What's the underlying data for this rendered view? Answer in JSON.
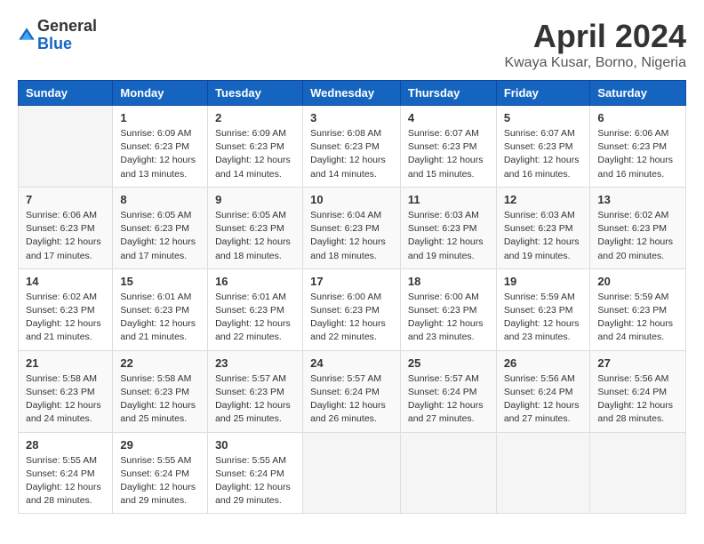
{
  "logo": {
    "general": "General",
    "blue": "Blue"
  },
  "title": "April 2024",
  "location": "Kwaya Kusar, Borno, Nigeria",
  "weekdays": [
    "Sunday",
    "Monday",
    "Tuesday",
    "Wednesday",
    "Thursday",
    "Friday",
    "Saturday"
  ],
  "weeks": [
    [
      {
        "day": "",
        "detail": ""
      },
      {
        "day": "1",
        "detail": "Sunrise: 6:09 AM\nSunset: 6:23 PM\nDaylight: 12 hours\nand 13 minutes."
      },
      {
        "day": "2",
        "detail": "Sunrise: 6:09 AM\nSunset: 6:23 PM\nDaylight: 12 hours\nand 14 minutes."
      },
      {
        "day": "3",
        "detail": "Sunrise: 6:08 AM\nSunset: 6:23 PM\nDaylight: 12 hours\nand 14 minutes."
      },
      {
        "day": "4",
        "detail": "Sunrise: 6:07 AM\nSunset: 6:23 PM\nDaylight: 12 hours\nand 15 minutes."
      },
      {
        "day": "5",
        "detail": "Sunrise: 6:07 AM\nSunset: 6:23 PM\nDaylight: 12 hours\nand 16 minutes."
      },
      {
        "day": "6",
        "detail": "Sunrise: 6:06 AM\nSunset: 6:23 PM\nDaylight: 12 hours\nand 16 minutes."
      }
    ],
    [
      {
        "day": "7",
        "detail": "Sunrise: 6:06 AM\nSunset: 6:23 PM\nDaylight: 12 hours\nand 17 minutes."
      },
      {
        "day": "8",
        "detail": "Sunrise: 6:05 AM\nSunset: 6:23 PM\nDaylight: 12 hours\nand 17 minutes."
      },
      {
        "day": "9",
        "detail": "Sunrise: 6:05 AM\nSunset: 6:23 PM\nDaylight: 12 hours\nand 18 minutes."
      },
      {
        "day": "10",
        "detail": "Sunrise: 6:04 AM\nSunset: 6:23 PM\nDaylight: 12 hours\nand 18 minutes."
      },
      {
        "day": "11",
        "detail": "Sunrise: 6:03 AM\nSunset: 6:23 PM\nDaylight: 12 hours\nand 19 minutes."
      },
      {
        "day": "12",
        "detail": "Sunrise: 6:03 AM\nSunset: 6:23 PM\nDaylight: 12 hours\nand 19 minutes."
      },
      {
        "day": "13",
        "detail": "Sunrise: 6:02 AM\nSunset: 6:23 PM\nDaylight: 12 hours\nand 20 minutes."
      }
    ],
    [
      {
        "day": "14",
        "detail": "Sunrise: 6:02 AM\nSunset: 6:23 PM\nDaylight: 12 hours\nand 21 minutes."
      },
      {
        "day": "15",
        "detail": "Sunrise: 6:01 AM\nSunset: 6:23 PM\nDaylight: 12 hours\nand 21 minutes."
      },
      {
        "day": "16",
        "detail": "Sunrise: 6:01 AM\nSunset: 6:23 PM\nDaylight: 12 hours\nand 22 minutes."
      },
      {
        "day": "17",
        "detail": "Sunrise: 6:00 AM\nSunset: 6:23 PM\nDaylight: 12 hours\nand 22 minutes."
      },
      {
        "day": "18",
        "detail": "Sunrise: 6:00 AM\nSunset: 6:23 PM\nDaylight: 12 hours\nand 23 minutes."
      },
      {
        "day": "19",
        "detail": "Sunrise: 5:59 AM\nSunset: 6:23 PM\nDaylight: 12 hours\nand 23 minutes."
      },
      {
        "day": "20",
        "detail": "Sunrise: 5:59 AM\nSunset: 6:23 PM\nDaylight: 12 hours\nand 24 minutes."
      }
    ],
    [
      {
        "day": "21",
        "detail": "Sunrise: 5:58 AM\nSunset: 6:23 PM\nDaylight: 12 hours\nand 24 minutes."
      },
      {
        "day": "22",
        "detail": "Sunrise: 5:58 AM\nSunset: 6:23 PM\nDaylight: 12 hours\nand 25 minutes."
      },
      {
        "day": "23",
        "detail": "Sunrise: 5:57 AM\nSunset: 6:23 PM\nDaylight: 12 hours\nand 25 minutes."
      },
      {
        "day": "24",
        "detail": "Sunrise: 5:57 AM\nSunset: 6:24 PM\nDaylight: 12 hours\nand 26 minutes."
      },
      {
        "day": "25",
        "detail": "Sunrise: 5:57 AM\nSunset: 6:24 PM\nDaylight: 12 hours\nand 27 minutes."
      },
      {
        "day": "26",
        "detail": "Sunrise: 5:56 AM\nSunset: 6:24 PM\nDaylight: 12 hours\nand 27 minutes."
      },
      {
        "day": "27",
        "detail": "Sunrise: 5:56 AM\nSunset: 6:24 PM\nDaylight: 12 hours\nand 28 minutes."
      }
    ],
    [
      {
        "day": "28",
        "detail": "Sunrise: 5:55 AM\nSunset: 6:24 PM\nDaylight: 12 hours\nand 28 minutes."
      },
      {
        "day": "29",
        "detail": "Sunrise: 5:55 AM\nSunset: 6:24 PM\nDaylight: 12 hours\nand 29 minutes."
      },
      {
        "day": "30",
        "detail": "Sunrise: 5:55 AM\nSunset: 6:24 PM\nDaylight: 12 hours\nand 29 minutes."
      },
      {
        "day": "",
        "detail": ""
      },
      {
        "day": "",
        "detail": ""
      },
      {
        "day": "",
        "detail": ""
      },
      {
        "day": "",
        "detail": ""
      }
    ]
  ]
}
